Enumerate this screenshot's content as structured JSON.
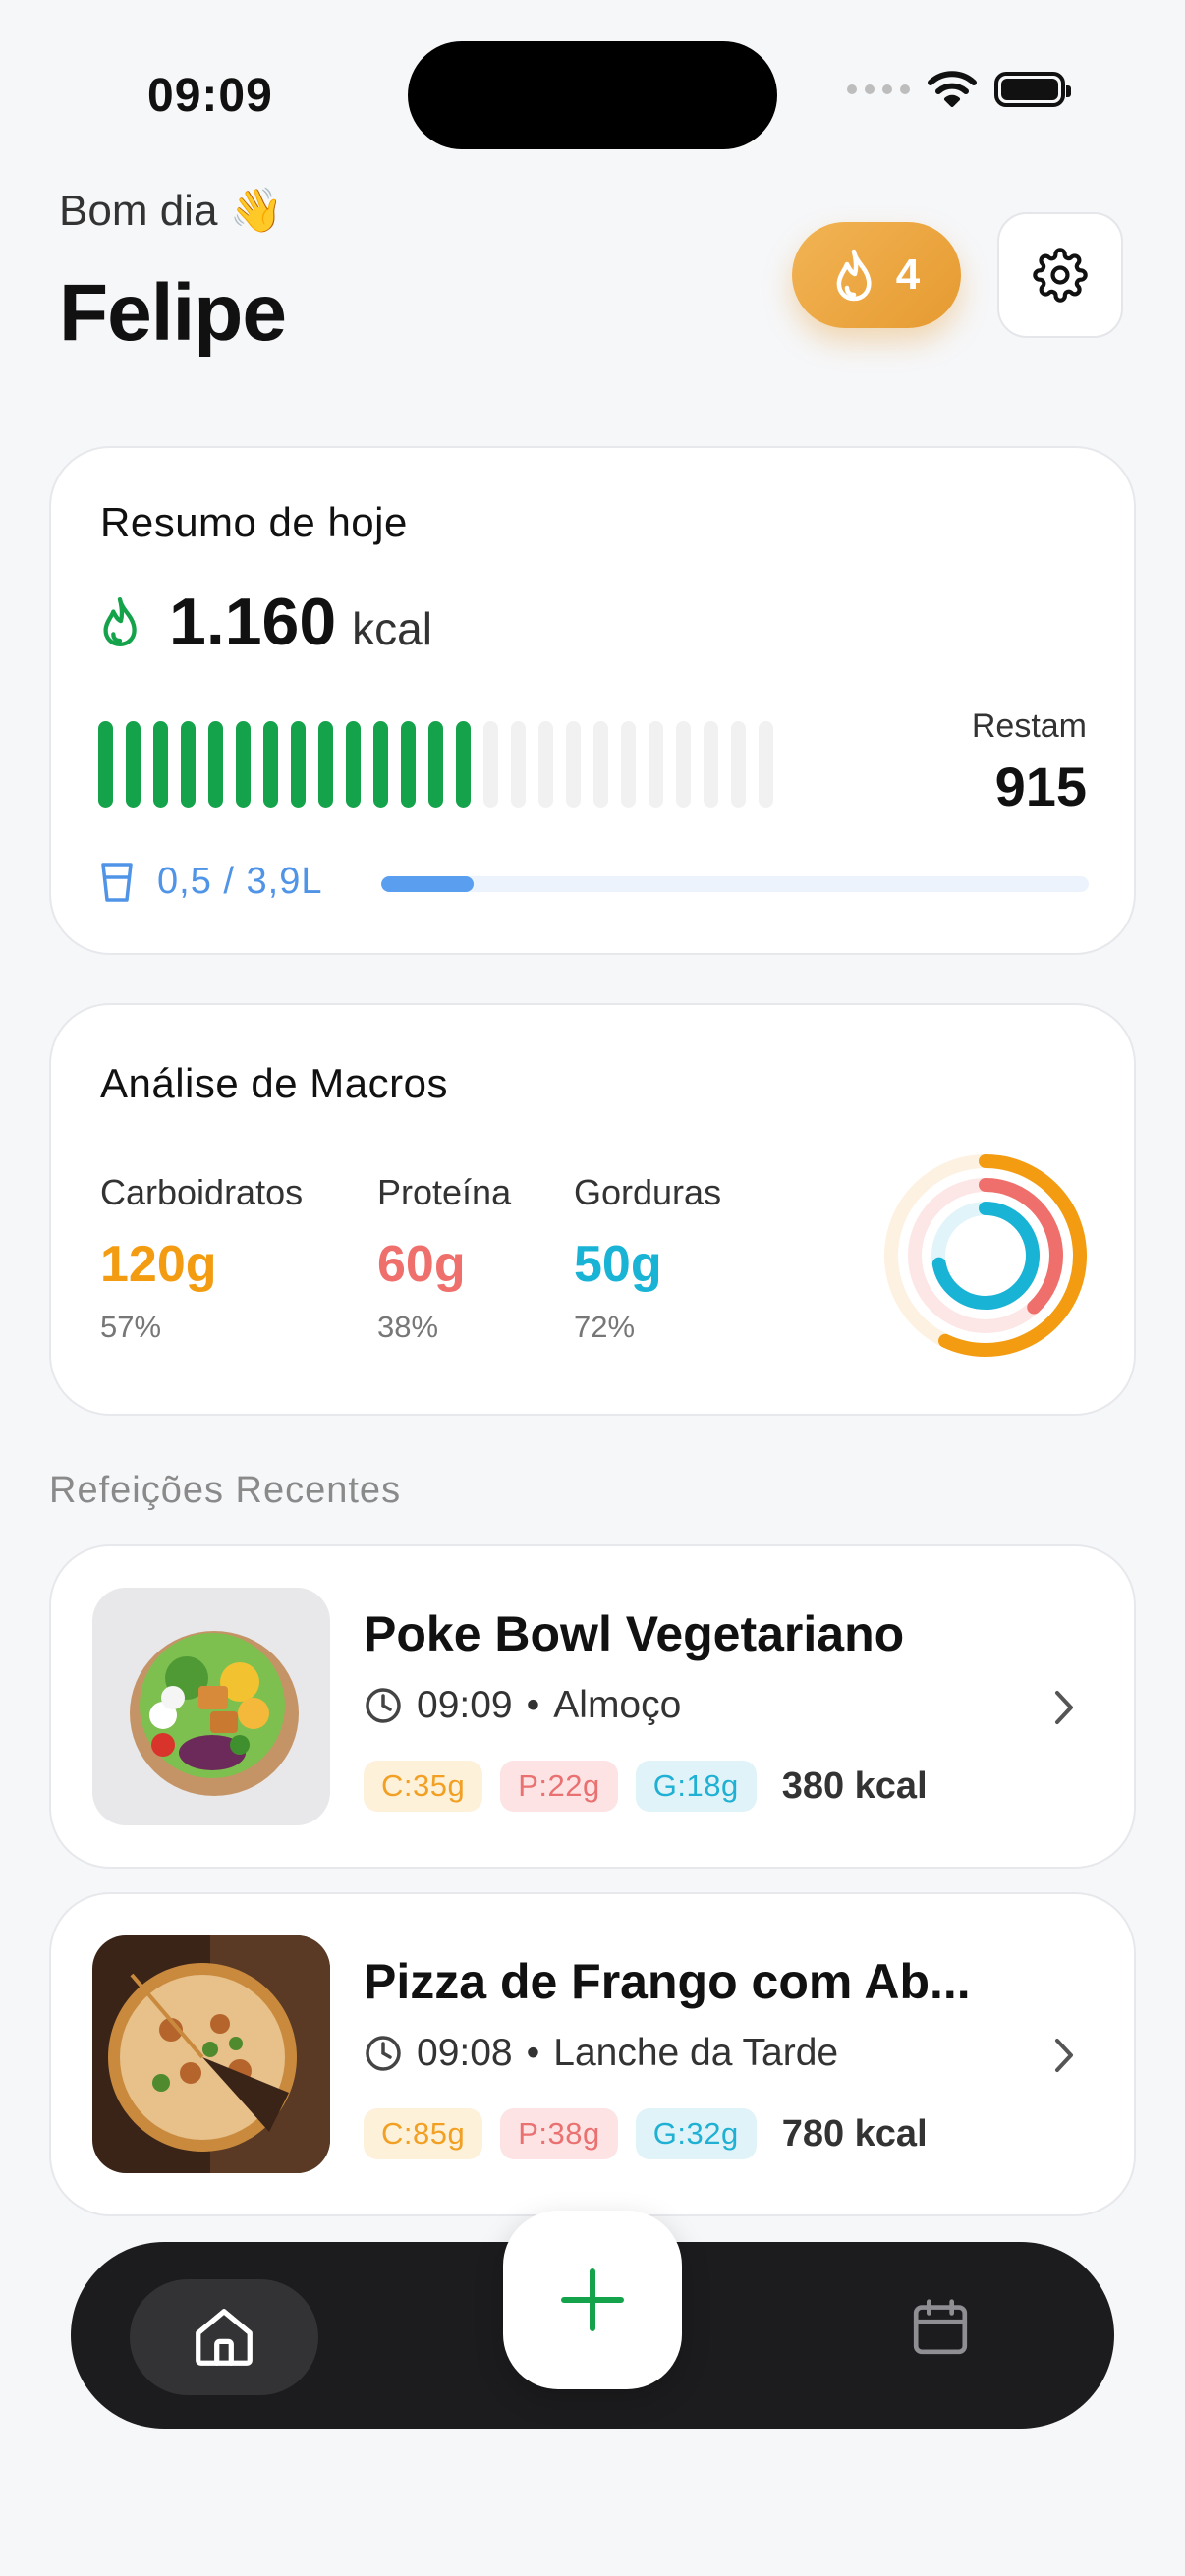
{
  "status_bar": {
    "time": "09:09"
  },
  "header": {
    "greeting": "Bom dia 👋",
    "username": "Felipe",
    "streak_count": "4",
    "icons": {
      "streak": "flame-icon",
      "settings": "gear-icon"
    }
  },
  "summary": {
    "title": "Resumo de hoje",
    "calories_value": "1.160",
    "calories_unit": "kcal",
    "remaining_label": "Restam",
    "remaining_value": "915",
    "calorie_progress_fraction": 0.56,
    "water_text": "0,5 / 3,9L",
    "water_progress_fraction": 0.13,
    "colors": {
      "calorie_bar": "#14a34a",
      "water": "#5a9ef0"
    }
  },
  "macros": {
    "title": "Análise de Macros",
    "items": [
      {
        "label": "Carboidratos",
        "value": "120g",
        "percent": "57%",
        "color": "#f39c12"
      },
      {
        "label": "Proteína",
        "value": "60g",
        "percent": "38%",
        "color": "#ef6f6c"
      },
      {
        "label": "Gorduras",
        "value": "50g",
        "percent": "72%",
        "color": "#19b3d6"
      }
    ]
  },
  "recent": {
    "section_label": "Refeições Recentes",
    "meals": [
      {
        "name": "Poke Bowl Vegetariano",
        "time": "09:09",
        "meal_type": "Almoço",
        "carbs": "C:35g",
        "protein": "P:22g",
        "fat": "G:18g",
        "kcal": "380 kcal"
      },
      {
        "name": "Pizza de Frango com Ab...",
        "time": "09:08",
        "meal_type": "Lanche da Tarde",
        "carbs": "C:85g",
        "protein": "P:38g",
        "fat": "G:32g",
        "kcal": "780 kcal"
      }
    ]
  },
  "nav": {
    "icons": {
      "home": "home-icon",
      "add": "plus-icon",
      "calendar": "calendar-icon"
    },
    "accent": "#14a34a"
  }
}
